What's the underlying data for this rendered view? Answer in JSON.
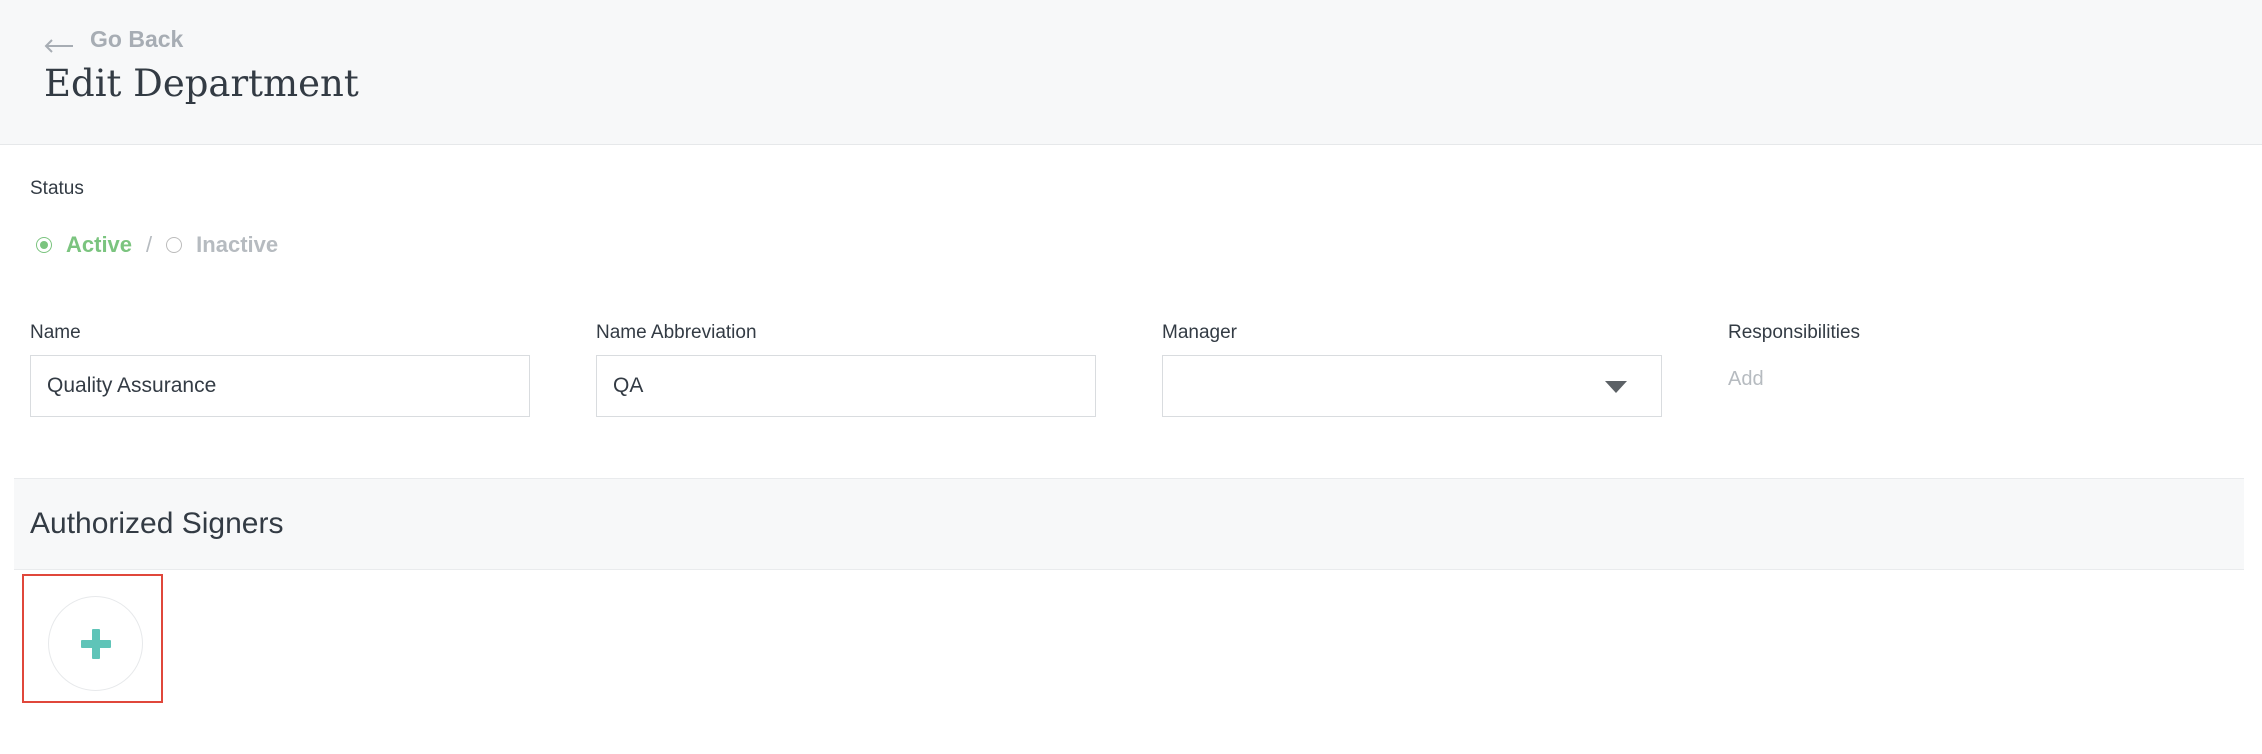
{
  "header": {
    "go_back": "Go Back",
    "title": "Edit Department"
  },
  "status": {
    "label": "Status",
    "options": [
      {
        "label": "Active",
        "selected": true
      },
      {
        "label": "Inactive",
        "selected": false
      }
    ],
    "separator": "/"
  },
  "fields": {
    "name": {
      "label": "Name",
      "value": "Quality Assurance"
    },
    "abbreviation": {
      "label": "Name Abbreviation",
      "value": "QA"
    },
    "manager": {
      "label": "Manager",
      "value": ""
    },
    "responsibilities": {
      "label": "Responsibilities",
      "add_label": "Add"
    }
  },
  "signers": {
    "title": "Authorized Signers"
  },
  "colors": {
    "accent_green": "#7bc47f",
    "plus_teal": "#5fc4b8",
    "highlight_red": "#e0473b"
  },
  "icons": {
    "back": "left-arrow-icon",
    "dropdown": "caret-down-icon",
    "add": "plus-icon"
  }
}
